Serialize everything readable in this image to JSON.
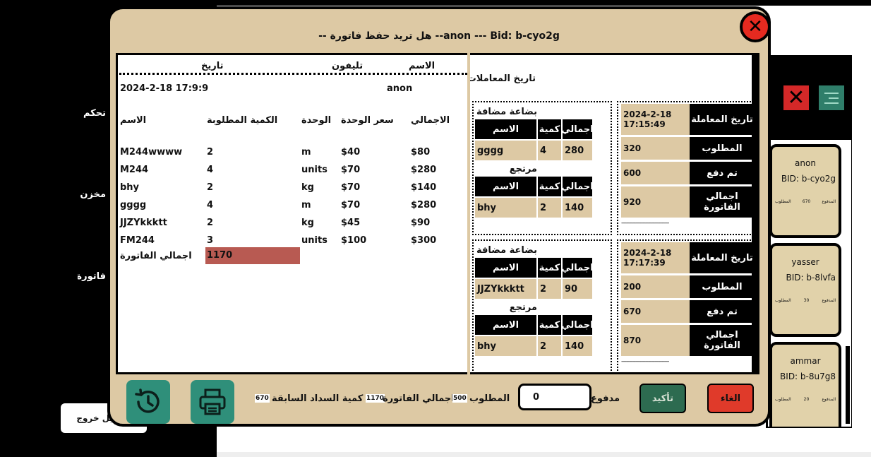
{
  "sidebar": {
    "items": [
      "تحكم",
      "مخزن",
      "فاتورة"
    ],
    "logout": "تسجيل خروج"
  },
  "right_panel": {
    "cards": [
      {
        "name": "anon",
        "bid": "BID: b-cyo2g",
        "paid_label": "المدفوع",
        "paid": "670",
        "due_label": "المطلوب"
      },
      {
        "name": "yasser",
        "bid": "BID: b-8lvfa",
        "paid_label": "المدفوع",
        "paid": "30",
        "due_label": "المطلوب"
      },
      {
        "name": "ammar",
        "bid": "BID: b-8u7g8",
        "paid_label": "المدفوع",
        "paid": "20",
        "due_label": "المطلوب"
      }
    ]
  },
  "modal": {
    "title": "-- هل تريد حفظ فاتورة --anon --- Bid: b-cyo2g",
    "invoice": {
      "hdr_name": "الاسم",
      "hdr_phone": "تليفون",
      "hdr_date": "تاريخ",
      "customer": "anon",
      "date": "2024-2-18 17:9:9",
      "columns": {
        "name": "الاسم",
        "qty": "الكمية المطلوبة",
        "unit": "الوحدة",
        "price": "سعر الوحدة",
        "total": "الاجمالي"
      },
      "rows": [
        {
          "name": "M244wwww",
          "qty": "2",
          "unit": "m",
          "price": "$40",
          "total": "$80"
        },
        {
          "name": "M244",
          "qty": "4",
          "unit": "units",
          "price": "$70",
          "total": "$280"
        },
        {
          "name": "bhy",
          "qty": "2",
          "unit": "kg",
          "price": "$70",
          "total": "$140"
        },
        {
          "name": "gggg",
          "qty": "4",
          "unit": "m",
          "price": "$70",
          "total": "$280"
        },
        {
          "name": "JJZYkkktt",
          "qty": "2",
          "unit": "kg",
          "price": "$45",
          "total": "$90"
        },
        {
          "name": "FM244",
          "qty": "3",
          "unit": "units",
          "price": "$100",
          "total": "$300"
        }
      ],
      "total_label": "اجمالي الفاتورة",
      "total_value": "1170"
    },
    "history": {
      "title": "تاريخ المعاملات",
      "col_total": "اجمالي",
      "col_qty": "كمية",
      "col_name": "الاسم",
      "added_label": "بضاعة مضافة",
      "returned_label": "مرتجع",
      "k_date": "تاريخ المعاملة",
      "k_due": "المطلوب",
      "k_paid": "تم دفع",
      "k_total": "اجمالي الفاتورة",
      "dash": "------------------------------",
      "transactions": [
        {
          "added": {
            "name": "gggg",
            "qty": "4",
            "total": "280"
          },
          "returned": {
            "name": "bhy",
            "qty": "2",
            "total": "140"
          },
          "date": "2024-2-18",
          "time": "17:15:49",
          "due": "320",
          "paid": "600",
          "total": "920"
        },
        {
          "added": {
            "name": "JJZYkkktt",
            "qty": "2",
            "total": "90"
          },
          "returned": {
            "name": "bhy",
            "qty": "2",
            "total": "140"
          },
          "date": "2024-2-18",
          "time": "17:17:39",
          "due": "200",
          "paid": "670",
          "total": "870"
        }
      ]
    },
    "footer": {
      "cancel": "الغاء",
      "confirm": "تأكيد",
      "paid_label": "مدفوع",
      "paid_value": "0",
      "due_label": "المطلوب",
      "due_value": "500",
      "invoice_total_label": "اجمالي الفاتورة",
      "invoice_total_value": "1170",
      "prev_label": "كمية السداد السابقة",
      "prev_value": "670"
    }
  },
  "colors": {
    "beige": "#ddc9a4",
    "teal": "#2f8f7a",
    "red": "#e52a20",
    "total_box": "#b85a52"
  }
}
